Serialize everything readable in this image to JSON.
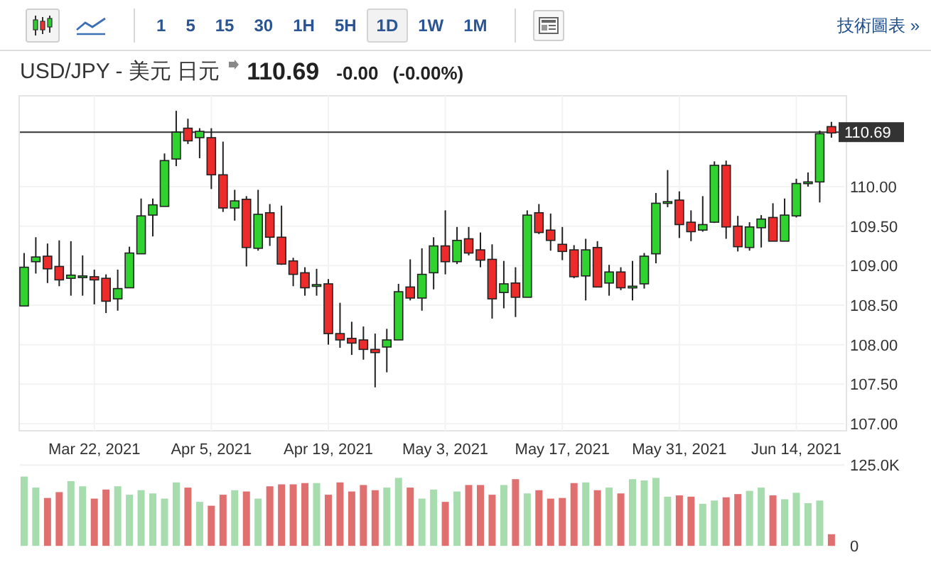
{
  "toolbar": {
    "chart_types": [
      {
        "kind": "candlestick",
        "selected": true
      },
      {
        "kind": "line",
        "selected": false
      }
    ],
    "intervals": [
      {
        "label": "1",
        "selected": false
      },
      {
        "label": "5",
        "selected": false
      },
      {
        "label": "15",
        "selected": false
      },
      {
        "label": "30",
        "selected": false
      },
      {
        "label": "1H",
        "selected": false
      },
      {
        "label": "5H",
        "selected": false
      },
      {
        "label": "1D",
        "selected": true
      },
      {
        "label": "1W",
        "selected": false
      },
      {
        "label": "1M",
        "selected": false
      }
    ],
    "link": "技術圖表 »"
  },
  "header": {
    "pair": "USD/JPY - 美元 日元",
    "price": "110.69",
    "change": "-0.00",
    "change_pct": "(-0.00%)"
  },
  "price_chart": {
    "chart_data": {
      "type": "candlestick",
      "categories": [
        null,
        null,
        null,
        null,
        null,
        null,
        "Mar 22, 2021",
        null,
        null,
        null,
        null,
        null,
        null,
        null,
        null,
        null,
        "Apr 5, 2021",
        null,
        null,
        null,
        null,
        null,
        null,
        null,
        null,
        null,
        "Apr 19, 2021",
        null,
        null,
        null,
        null,
        null,
        null,
        null,
        null,
        null,
        "May 3, 2021",
        null,
        null,
        null,
        null,
        null,
        null,
        null,
        null,
        null,
        "May 17, 2021",
        null,
        null,
        null,
        null,
        null,
        null,
        null,
        null,
        null,
        "May 31, 2021",
        null,
        null,
        null,
        null,
        null,
        null,
        null,
        null,
        null,
        "Jun 14, 2021",
        null,
        null,
        null
      ],
      "ohlc": [
        [
          108.49,
          109.16,
          108.49,
          108.98
        ],
        [
          109.05,
          109.36,
          108.9,
          109.11
        ],
        [
          109.12,
          109.28,
          108.78,
          108.96
        ],
        [
          108.99,
          109.32,
          108.74,
          108.82
        ],
        [
          108.84,
          109.31,
          108.62,
          108.88
        ],
        [
          108.87,
          109.13,
          108.62,
          108.87
        ],
        [
          108.86,
          108.95,
          108.51,
          108.82
        ],
        [
          108.84,
          108.89,
          108.4,
          108.55
        ],
        [
          108.58,
          108.95,
          108.43,
          108.71
        ],
        [
          108.72,
          109.24,
          108.72,
          109.16
        ],
        [
          109.15,
          109.85,
          109.15,
          109.63
        ],
        [
          109.64,
          109.85,
          109.37,
          109.77
        ],
        [
          109.75,
          110.42,
          109.75,
          110.33
        ],
        [
          110.35,
          110.96,
          110.26,
          110.69
        ],
        [
          110.74,
          110.86,
          110.54,
          110.58
        ],
        [
          110.62,
          110.74,
          110.36,
          110.7
        ],
        [
          110.62,
          110.74,
          109.97,
          110.15
        ],
        [
          110.15,
          110.57,
          109.68,
          109.73
        ],
        [
          109.73,
          109.96,
          109.57,
          109.82
        ],
        [
          109.84,
          109.88,
          108.99,
          109.23
        ],
        [
          109.22,
          109.96,
          109.19,
          109.65
        ],
        [
          109.67,
          109.78,
          109.25,
          109.36
        ],
        [
          109.36,
          109.76,
          109.01,
          109.02
        ],
        [
          109.06,
          109.1,
          108.74,
          108.89
        ],
        [
          108.91,
          108.98,
          108.62,
          108.72
        ],
        [
          108.76,
          108.96,
          108.62,
          108.76
        ],
        [
          108.77,
          108.83,
          108.0,
          108.14
        ],
        [
          108.14,
          108.53,
          107.96,
          108.06
        ],
        [
          108.08,
          108.29,
          107.87,
          108.02
        ],
        [
          108.06,
          108.23,
          107.81,
          107.94
        ],
        [
          107.94,
          108.14,
          107.46,
          107.9
        ],
        [
          107.97,
          108.2,
          107.65,
          108.06
        ],
        [
          108.06,
          108.77,
          108.06,
          108.67
        ],
        [
          108.73,
          109.08,
          108.56,
          108.59
        ],
        [
          108.59,
          109.22,
          108.43,
          108.89
        ],
        [
          108.91,
          109.36,
          108.7,
          109.25
        ],
        [
          109.25,
          109.7,
          108.89,
          109.05
        ],
        [
          109.05,
          109.49,
          109.02,
          109.32
        ],
        [
          109.34,
          109.49,
          109.13,
          109.16
        ],
        [
          109.2,
          109.42,
          108.98,
          109.07
        ],
        [
          109.08,
          109.27,
          108.33,
          108.58
        ],
        [
          108.66,
          109.06,
          108.46,
          108.77
        ],
        [
          108.78,
          108.98,
          108.35,
          108.6
        ],
        [
          108.6,
          109.7,
          108.6,
          109.64
        ],
        [
          109.67,
          109.78,
          109.4,
          109.42
        ],
        [
          109.45,
          109.66,
          109.19,
          109.32
        ],
        [
          109.27,
          109.49,
          109.07,
          109.18
        ],
        [
          109.2,
          109.26,
          108.84,
          108.86
        ],
        [
          108.87,
          109.34,
          108.56,
          109.2
        ],
        [
          109.23,
          109.31,
          108.73,
          108.73
        ],
        [
          108.78,
          109.01,
          108.62,
          108.92
        ],
        [
          108.92,
          108.98,
          108.69,
          108.72
        ],
        [
          108.74,
          109.06,
          108.56,
          108.74
        ],
        [
          108.77,
          109.16,
          108.71,
          109.12
        ],
        [
          109.15,
          109.92,
          109.03,
          109.79
        ],
        [
          109.8,
          110.21,
          109.74,
          109.81
        ],
        [
          109.83,
          109.94,
          109.35,
          109.52
        ],
        [
          109.55,
          109.7,
          109.31,
          109.43
        ],
        [
          109.45,
          109.88,
          109.43,
          109.52
        ],
        [
          109.55,
          110.32,
          109.54,
          110.27
        ],
        [
          110.27,
          110.33,
          109.34,
          109.49
        ],
        [
          109.5,
          109.63,
          109.18,
          109.24
        ],
        [
          109.23,
          109.55,
          109.19,
          109.49
        ],
        [
          109.48,
          109.64,
          109.23,
          109.59
        ],
        [
          109.61,
          109.79,
          109.31,
          109.31
        ],
        [
          109.31,
          109.85,
          109.31,
          109.64
        ],
        [
          109.63,
          110.1,
          109.61,
          110.04
        ],
        [
          110.06,
          110.18,
          110.0,
          110.06
        ],
        [
          110.06,
          110.71,
          109.8,
          110.67
        ],
        [
          110.76,
          110.82,
          110.62,
          110.68
        ]
      ],
      "ylim": [
        106.91,
        111.15
      ],
      "yticks": [
        {
          "value": 107,
          "label": "107.00"
        },
        {
          "value": 107.5,
          "label": "107.50"
        },
        {
          "value": 108,
          "label": "108.00"
        },
        {
          "value": 108.5,
          "label": "108.50"
        },
        {
          "value": 109,
          "label": "109.00"
        },
        {
          "value": 109.5,
          "label": "109.50"
        },
        {
          "value": 110,
          "label": "110.00"
        }
      ],
      "grid": true,
      "ref_lines": [
        {
          "axis": "y",
          "value": 110.69,
          "label": "110.69"
        }
      ]
    }
  },
  "volume_chart": {
    "chart_data": {
      "type": "bar",
      "categories": [
        null,
        null,
        null,
        null,
        null,
        null,
        null,
        null,
        null,
        null,
        null,
        null,
        null,
        null,
        null,
        null,
        null,
        null,
        null,
        null,
        null,
        null,
        null,
        null,
        null,
        null,
        null,
        null,
        null,
        null,
        null,
        null,
        null,
        null,
        null,
        null,
        null,
        null,
        null,
        null,
        null,
        null,
        null,
        null,
        null,
        null,
        null,
        null,
        null,
        null,
        null,
        null,
        null,
        null,
        null,
        null,
        null,
        null,
        null,
        null,
        null,
        null,
        null,
        null,
        null,
        null,
        null,
        null,
        null,
        null
      ],
      "values": [
        107,
        90,
        74,
        83,
        100,
        92,
        73,
        87,
        92,
        79,
        86,
        81,
        73,
        98,
        90,
        68,
        62,
        79,
        86,
        84,
        73,
        92,
        95,
        95,
        97,
        97,
        79,
        98,
        84,
        94,
        86,
        90,
        105,
        90,
        73,
        87,
        68,
        84,
        94,
        94,
        79,
        94,
        103,
        81,
        86,
        73,
        74,
        97,
        98,
        86,
        90,
        81,
        103,
        101,
        105,
        76,
        78,
        76,
        65,
        70,
        75,
        80,
        85,
        90,
        78,
        72,
        82,
        66,
        70,
        18
      ],
      "ylim": [
        0,
        135
      ],
      "yticks": [
        {
          "value": 0,
          "label": "0"
        },
        {
          "value": 125,
          "label": "125.0K"
        }
      ]
    }
  }
}
